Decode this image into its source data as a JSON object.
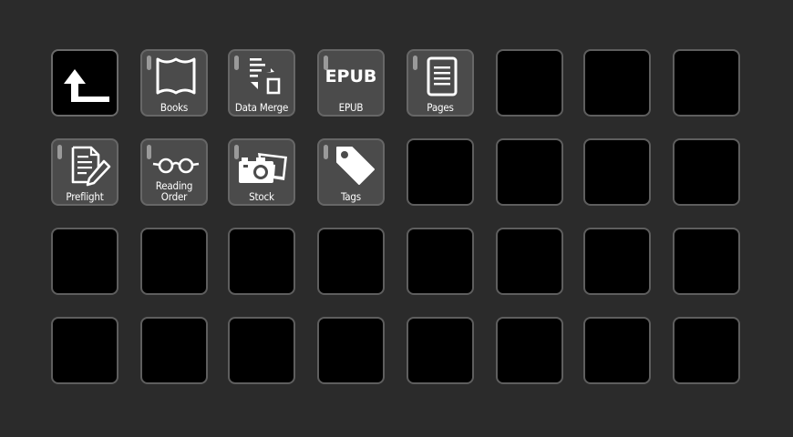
{
  "window": {
    "title": ""
  },
  "keys": {
    "back": {
      "icon": "back-arrow-icon"
    },
    "books": {
      "label": "Books",
      "icon": "open-book-icon"
    },
    "data_merge": {
      "label": "Data Merge",
      "icon": "data-merge-icon"
    },
    "epub": {
      "label": "EPUB",
      "icon_text": "EPUB"
    },
    "pages": {
      "label": "Pages",
      "icon": "page-document-icon"
    },
    "preflight": {
      "label": "Preflight",
      "icon": "preflight-pencil-icon"
    },
    "reading_order": {
      "label": "Reading\nOrder",
      "icon": "glasses-icon"
    },
    "stock": {
      "label": "Stock",
      "icon": "camera-photos-icon"
    },
    "tags": {
      "label": "Tags",
      "icon": "tag-icon"
    }
  },
  "empty_key_count": 23,
  "colors": {
    "background": "#2b2b2b",
    "key_fill": "#4b4b4b",
    "empty_key": "#000000",
    "border": "#5e5e5e"
  }
}
